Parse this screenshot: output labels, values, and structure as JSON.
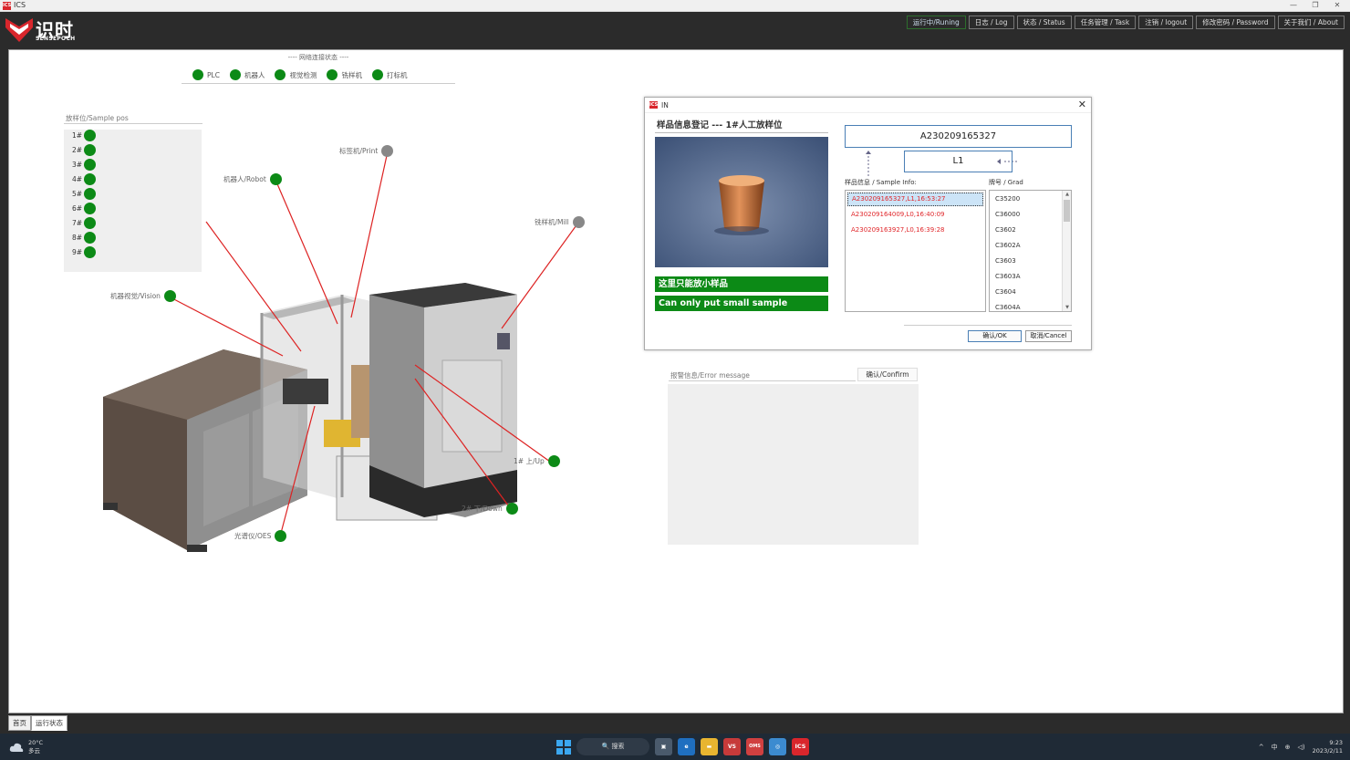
{
  "window": {
    "app_icon": "ICS",
    "title": "ICS",
    "minimize": "—",
    "restore": "❐",
    "close": "✕"
  },
  "logo": {
    "cn": "识时",
    "en": "SENSEPOCH"
  },
  "nav": {
    "running": "运行中/Runing",
    "log": "日志 / Log",
    "status": "状态 / Status",
    "task": "任务管理 / Task",
    "logout": "注销 / logout",
    "password": "修改密码 / Password",
    "about": "关于我们 / About"
  },
  "netstatus": {
    "caption": "---- 网络连接状态 ----",
    "items": [
      "PLC",
      "机器人",
      "视觉检测",
      "铣样机",
      "打标机"
    ]
  },
  "sample_pos": {
    "caption": "放样位/Sample pos",
    "slots": [
      "1#",
      "2#",
      "3#",
      "4#",
      "5#",
      "6#",
      "7#",
      "8#",
      "9#"
    ]
  },
  "callouts": {
    "print": "标签机/Print",
    "robot": "机器人/Robot",
    "mill": "铣样机/Mill",
    "vision": "机器视觉/Vision",
    "up": "1# 上/Up",
    "down": "2# 下/Down",
    "oes": "光谱仪/OES"
  },
  "colors": {
    "status_green": "#0c8a16",
    "status_gray": "#888888",
    "brand_red": "#d9262c",
    "error_red": "#e0262a"
  },
  "dialog": {
    "icon": "ICS",
    "title": "IN",
    "close": "✕",
    "heading": "样品信息登记 --- 1#人工放样位",
    "warn_cn": "这里只能放小样品",
    "warn_en": "Can only put small sample",
    "sample_id": "A230209165327",
    "location": "L1",
    "sample_info_label": "样品信息 / Sample Info:",
    "grade_label": "牌号 / Grad",
    "samples": [
      "A230209165327,L1,16:53:27",
      "A230209164009,L0,16:40:09",
      "A230209163927,L0,16:39:28"
    ],
    "grades": [
      "C35200",
      "C36000",
      "C3602",
      "C3602A",
      "C3603",
      "C3603A",
      "C3604",
      "C3604A"
    ],
    "ok": "确认/OK",
    "cancel": "取消/Cancel"
  },
  "error": {
    "caption": "报警信息/Error message",
    "confirm": "确认/Confirm"
  },
  "tabs": [
    "首页",
    "运行状态"
  ],
  "taskbar": {
    "temp": "20°C",
    "weather": "多云",
    "search": "搜索",
    "apps": [
      "VS",
      "OMS",
      "ICS"
    ],
    "ime": "中",
    "time": "9:23",
    "date": "2023/2/11"
  }
}
